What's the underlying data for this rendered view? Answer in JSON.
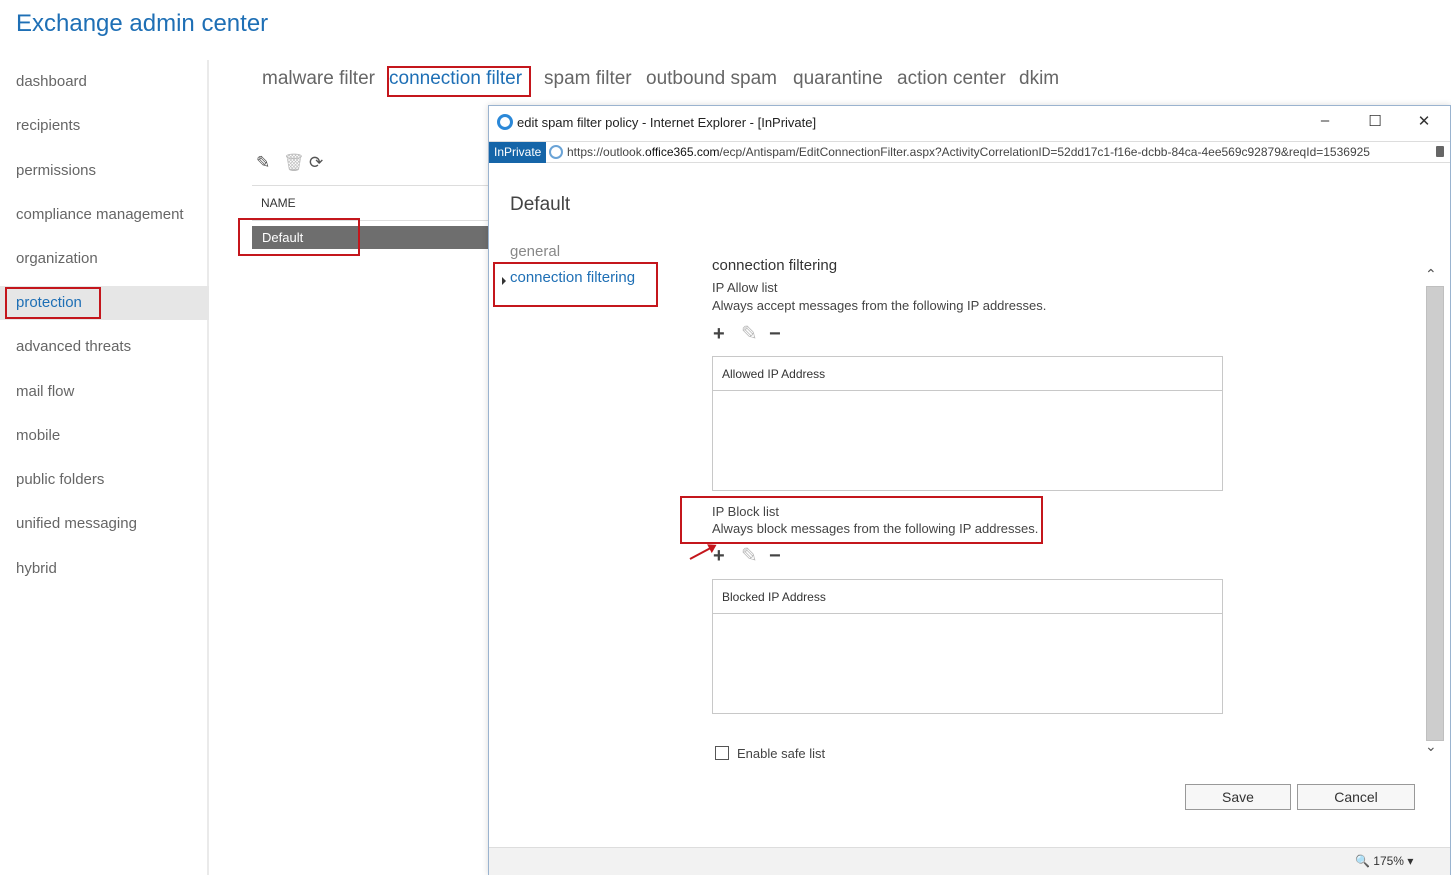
{
  "app": {
    "title": "Exchange admin center"
  },
  "nav": {
    "items": [
      {
        "label": "dashboard"
      },
      {
        "label": "recipients"
      },
      {
        "label": "permissions"
      },
      {
        "label": "compliance management"
      },
      {
        "label": "organization"
      },
      {
        "label": "protection",
        "selected": true
      },
      {
        "label": "advanced threats"
      },
      {
        "label": "mail flow"
      },
      {
        "label": "mobile"
      },
      {
        "label": "public folders"
      },
      {
        "label": "unified messaging"
      },
      {
        "label": "hybrid"
      }
    ]
  },
  "tabs": [
    {
      "label": "malware filter"
    },
    {
      "label": "connection filter",
      "selected": true
    },
    {
      "label": "spam filter"
    },
    {
      "label": "outbound spam"
    },
    {
      "label": "quarantine"
    },
    {
      "label": "action center"
    },
    {
      "label": "dkim"
    }
  ],
  "list": {
    "toolbar_icons": [
      "pencil-icon",
      "trash-icon",
      "refresh-icon"
    ],
    "column_header": "NAME",
    "rows": [
      {
        "name": "Default",
        "selected": true
      }
    ]
  },
  "popup": {
    "window_title": "edit spam filter policy - Internet Explorer - [InPrivate]",
    "window_buttons": [
      "minimize",
      "maximize",
      "close"
    ],
    "inprivate_badge": "InPrivate",
    "url_prefix": "https://outlook.",
    "url_domain": "office365.com",
    "url_path": "/ecp/Antispam/EditConnectionFilter.aspx?ActivityCorrelationID=52dd17c1-f16e-dcbb-84ca-4ee569c92879&reqId=1536925",
    "policy_name": "Default",
    "side_nav": [
      {
        "label": "general"
      },
      {
        "label": "connection filtering",
        "selected": true
      }
    ],
    "section_title": "connection filtering",
    "allow": {
      "title": "IP Allow list",
      "description": "Always accept messages from the following IP addresses.",
      "column_header": "Allowed IP Address"
    },
    "block": {
      "title": "IP Block list",
      "description": "Always block messages from the following IP addresses.",
      "column_header": "Blocked IP Address"
    },
    "safe_list_label": "Enable safe list",
    "safe_list_checked": false,
    "save_label": "Save",
    "cancel_label": "Cancel",
    "zoom_level": "175%",
    "accent_color": "#1e6fb5",
    "highlight_color": "#c4161c"
  }
}
